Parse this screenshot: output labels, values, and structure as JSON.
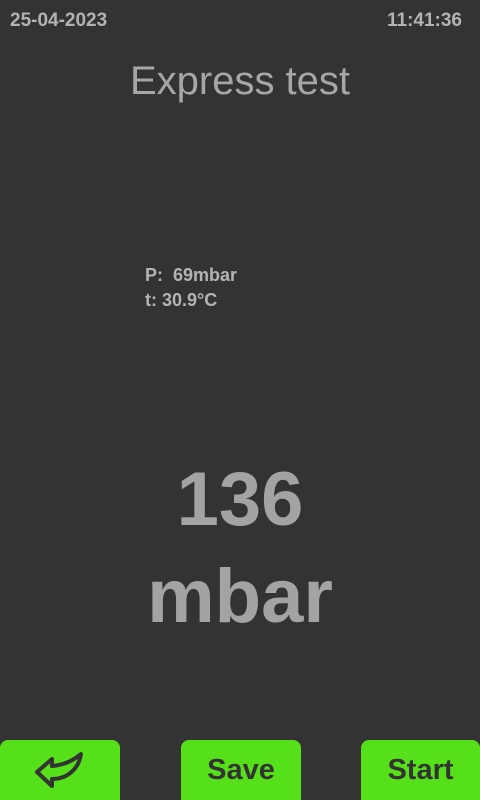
{
  "status": {
    "date": "25-04-2023",
    "time": "11:41:36"
  },
  "title": "Express test",
  "readouts": {
    "pressure": "P:  69mbar",
    "temperature": "t: 30.9°C"
  },
  "main_value": {
    "number": "136",
    "unit": "mbar"
  },
  "buttons": {
    "back_icon": "return-arrow-icon",
    "save_label": "Save",
    "start_label": "Start"
  },
  "colors": {
    "background": "#333333",
    "button": "#55e01a",
    "text": "#a8a8a8"
  }
}
